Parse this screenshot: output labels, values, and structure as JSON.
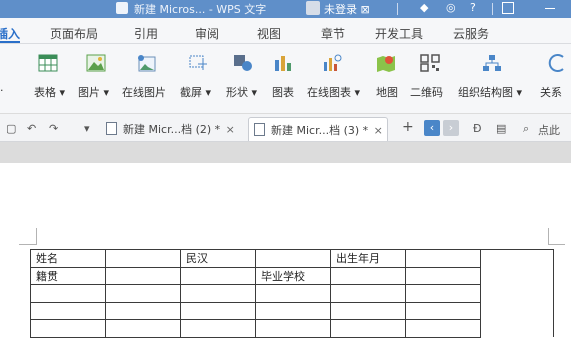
{
  "titlebar": {
    "title": "新建 Micros... - WPS 文字",
    "login": "未登录",
    "icons": [
      "document-icon",
      "user-avatar-icon",
      "dropdown-icon",
      "help-icon",
      "settings-icon",
      "question-icon",
      "restore-icon",
      "minimize-icon"
    ]
  },
  "menu": {
    "tabs": [
      "插入",
      "页面布局",
      "引用",
      "审阅",
      "视图",
      "章节",
      "开发工具",
      "云服务"
    ],
    "active_index": 0
  },
  "ribbon": {
    "items": [
      {
        "label": "表格",
        "icon": "table-icon"
      },
      {
        "label": "图片",
        "icon": "picture-icon"
      },
      {
        "label": "在线图片",
        "icon": "online-picture-icon"
      },
      {
        "label": "截屏",
        "icon": "screenshot-icon"
      },
      {
        "label": "形状",
        "icon": "shapes-icon"
      },
      {
        "label": "图表",
        "icon": "chart-icon"
      },
      {
        "label": "在线图表",
        "icon": "online-chart-icon"
      },
      {
        "label": "地图",
        "icon": "map-icon"
      },
      {
        "label": "二维码",
        "icon": "qrcode-icon"
      },
      {
        "label": "组织结构图",
        "icon": "org-chart-icon"
      },
      {
        "label": "关系",
        "icon": "relation-icon"
      }
    ]
  },
  "doc_tabs": [
    {
      "label": "新建 Micr...档 (2) *",
      "active": false
    },
    {
      "label": "新建 Micr...档 (3) *",
      "active": true
    }
  ],
  "quickbar": {
    "search_label": "点此",
    "new_tab": "+",
    "prev": "‹",
    "next": "›"
  },
  "form_table": {
    "rows": [
      [
        "姓名",
        "",
        "民汉",
        "",
        "出生年月",
        ""
      ],
      [
        "籍贯",
        "",
        "",
        "毕业学校",
        "",
        ""
      ],
      [
        "",
        "",
        "",
        "",
        "",
        ""
      ],
      [
        "",
        "",
        "",
        "",
        "",
        ""
      ],
      [
        "",
        "",
        "",
        "",
        "",
        ""
      ]
    ]
  },
  "colors": {
    "titlebar": "#5f8fc9",
    "accent": "#2a6fc9",
    "ribbon_bg": "#f6f7f9",
    "page_gap": "#dcdcdc"
  }
}
